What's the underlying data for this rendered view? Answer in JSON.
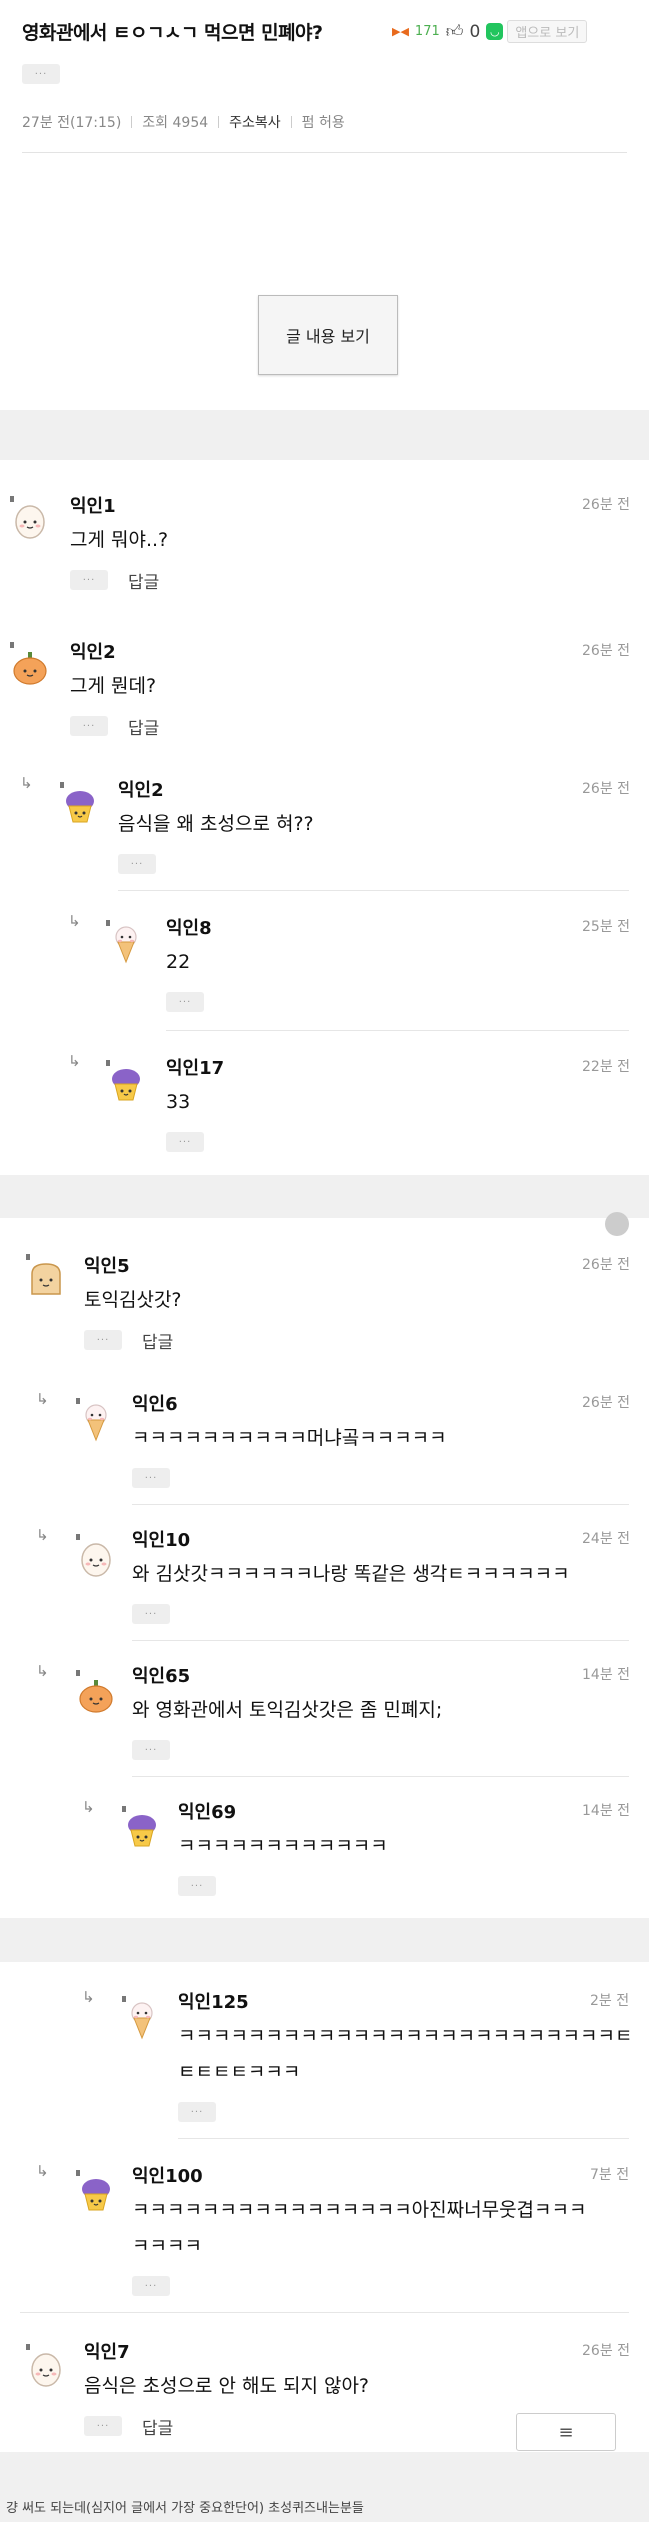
{
  "post": {
    "title": "영화관에서 ㅌㅇㄱㅅㄱ 먹으면 민폐야?",
    "views_badge": "171",
    "likes": "0",
    "app_button_label": "앱으로 보기",
    "dots": "···",
    "time": "27분 전(17:15)",
    "views": "조회 4954",
    "copy_address": "주소복사",
    "source_link": "펌 허용",
    "view_content_button": "글 내용 보기"
  },
  "comments": [
    {
      "name": "익인1",
      "time": "26분 전",
      "text": "그게 뭐야..?",
      "reply": "답글",
      "dots": "···",
      "avatar": "egg-icon"
    },
    {
      "name": "익인2",
      "time": "26분 전",
      "text": "그게 뭔데?",
      "reply": "답글",
      "dots": "···",
      "avatar": "pumpkin-icon"
    },
    {
      "name": "익인2",
      "time": "26분 전",
      "text": "음식을 왜 초성으로 혀??",
      "dots": "···",
      "avatar": "cupcake-icon"
    },
    {
      "name": "익인8",
      "time": "25분 전",
      "text": "22",
      "dots": "···",
      "avatar": "icecream-icon"
    },
    {
      "name": "익인17",
      "time": "22분 전",
      "text": "33",
      "dots": "···",
      "avatar": "cupcake-icon"
    },
    {
      "name": "익인5",
      "time": "26분 전",
      "text": "토익김삿갓?",
      "reply": "답글",
      "dots": "···",
      "avatar": "toast-icon"
    },
    {
      "name": "익인6",
      "time": "26분 전",
      "text": "ㅋㅋㅋㅋㅋㅋㅋㅋㅋㅋ머냐곸ㅋㅋㅋㅋㅋ",
      "dots": "···",
      "avatar": "icecream-icon"
    },
    {
      "name": "익인10",
      "time": "24분 전",
      "text": "와 김삿갓ㅋㅋㅋㅋㅋㅋ나랑 똑같은 생각ㅌㅋㅋㅋㅋㅋㅋ",
      "dots": "···",
      "avatar": "egg-icon"
    },
    {
      "name": "익인65",
      "time": "14분 전",
      "text": "와 영화관에서 토익김삿갓은 좀 민폐지;",
      "dots": "···",
      "avatar": "pumpkin-icon"
    },
    {
      "name": "익인69",
      "time": "14분 전",
      "text": "ㅋㅋㅋㅋㅋㅋㅋㅋㅋㅋㅋㅋ",
      "dots": "···",
      "avatar": "cupcake-icon"
    },
    {
      "name": "익인125",
      "time": "2분 전",
      "text": "ㅋㅋㅋㅋㅋㅋㅋㅋㅋㅋㅋㅋㅋㅋㅋㅋㅋㅋㅋㅋㅋㅋㅋㅋㅋㅌㅌ",
      "text2": "ㅌㅌㅌㅌㅋㅋㅋ",
      "dots": "···",
      "avatar": "icecream-icon"
    },
    {
      "name": "익인100",
      "time": "7분 전",
      "text": "ㅋㅋㅋㅋㅋㅋㅋㅋㅋㅋㅋㅋㅋㅋㅋㅋ아진짜너무웃겹ㅋㅋㅋ",
      "text2": "ㅋㅋㅋㅋ",
      "dots": "···",
      "avatar": "cupcake-icon"
    },
    {
      "name": "익인7",
      "time": "26분 전",
      "text": "음식은 초성으로 안 해도 되지 않아?",
      "reply": "답글",
      "dots": "···",
      "avatar": "egg-icon"
    }
  ],
  "menu_icon": "≡",
  "footer_text": "걍 써도 되는데(심지어 글에서 가장 중요한단어) 초성퀴즈내는분들"
}
